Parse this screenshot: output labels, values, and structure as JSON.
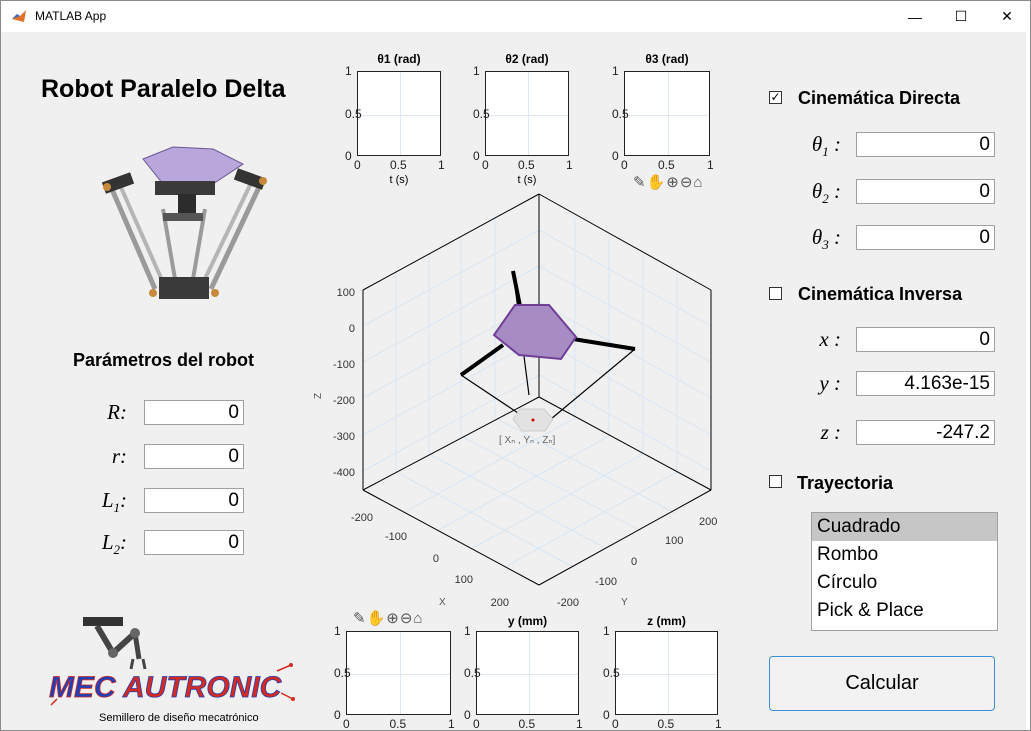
{
  "window": {
    "title": "MATLAB App",
    "minimize_glyph": "—",
    "maximize_glyph": "☐",
    "close_glyph": "✕"
  },
  "app_title": "Robot Paralelo Delta",
  "params": {
    "heading": "Parámetros del robot",
    "fields": [
      {
        "label": "R",
        "value": "0"
      },
      {
        "label": "r",
        "value": "0"
      },
      {
        "label": "L1",
        "value": "0"
      },
      {
        "label": "L2",
        "value": "0"
      }
    ]
  },
  "top_plots": [
    {
      "title": "θ1 (rad)",
      "xlabel": "t (s)"
    },
    {
      "title": "θ2 (rad)",
      "xlabel": "t (s)"
    },
    {
      "title": "θ3 (rad)",
      "xlabel": ""
    }
  ],
  "bottom_plots": [
    {
      "title": ""
    },
    {
      "title": "y (mm)"
    },
    {
      "title": "z (mm)"
    }
  ],
  "small_axis": {
    "yticks": [
      "1",
      "0.5",
      "0"
    ],
    "xticks": [
      "0",
      "0.5",
      "1"
    ]
  },
  "plot3d": {
    "z_ticks": [
      "100",
      "0",
      "-100",
      "-200",
      "-300",
      "-400"
    ],
    "z_label": "Z",
    "x_ticks": [
      "-200",
      "-100",
      "0",
      "100",
      "200"
    ],
    "x_label": "X",
    "y_ticks": [
      "200",
      "100",
      "0",
      "-100",
      "-200"
    ],
    "y_label": "Y",
    "point_label": "[ Xₙ , Yₙ , Zₙ]"
  },
  "toolbar_icons": [
    "brush-icon",
    "pan-icon",
    "zoom-in-icon",
    "zoom-out-icon",
    "home-icon"
  ],
  "toolbar_glyphs": "✎✋⊕⊖⌂",
  "directa": {
    "checked": true,
    "label": "Cinemática Directa",
    "check_glyph": "✓",
    "fields": [
      {
        "label": "θ1 :",
        "value": "0"
      },
      {
        "label": "θ2 :",
        "value": "0"
      },
      {
        "label": "θ3 :",
        "value": "0"
      }
    ]
  },
  "inversa": {
    "checked": false,
    "label": "Cinemática Inversa",
    "fields": [
      {
        "label": "x :",
        "value": "0"
      },
      {
        "label": "y :",
        "value": "4.163e-15"
      },
      {
        "label": "z :",
        "value": "-247.2"
      }
    ]
  },
  "trayectoria": {
    "checked": false,
    "label": "Trayectoria",
    "options": [
      "Cuadrado",
      "Rombo",
      "Círculo",
      "Pick & Place"
    ],
    "selected": "Cuadrado"
  },
  "calc_button": "Calcular",
  "logo": {
    "brand": "MECAUTRONIC",
    "tagline": "Semillero de diseño mecatrónico"
  },
  "colors": {
    "platform_fill": "#a68bc4",
    "platform_edge": "#6f3f95",
    "button_border": "#3b8fd6",
    "logo_blue": "#1f3fb8",
    "logo_red": "#d42a1f"
  }
}
